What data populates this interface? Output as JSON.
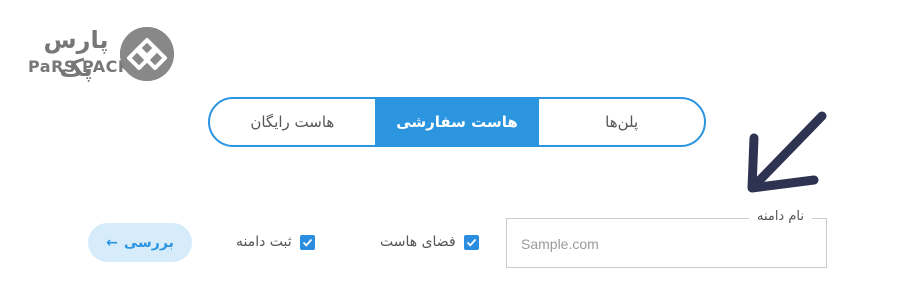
{
  "brand": {
    "name_fa": "پارس پک",
    "name_en": "PaRS PACK"
  },
  "tabs": [
    {
      "label": "پلن‌ها",
      "active": false
    },
    {
      "label": "هاست سفارشی",
      "active": true
    },
    {
      "label": "هاست رایگان",
      "active": false
    }
  ],
  "domain": {
    "legend": "نام دامنه",
    "placeholder": "Sample.com",
    "value": ""
  },
  "options": {
    "hosting_label": "فضای هاست",
    "hosting_checked": true,
    "register_label": "ثبت دامنه",
    "register_checked": true
  },
  "review_button": {
    "label": "بررسی",
    "icon": "arrow-left-icon"
  },
  "colors": {
    "accent": "#2b95e0",
    "button_bg": "#d6ecfb",
    "logo_gray": "#888888",
    "annotation_arrow": "#2e3352"
  }
}
